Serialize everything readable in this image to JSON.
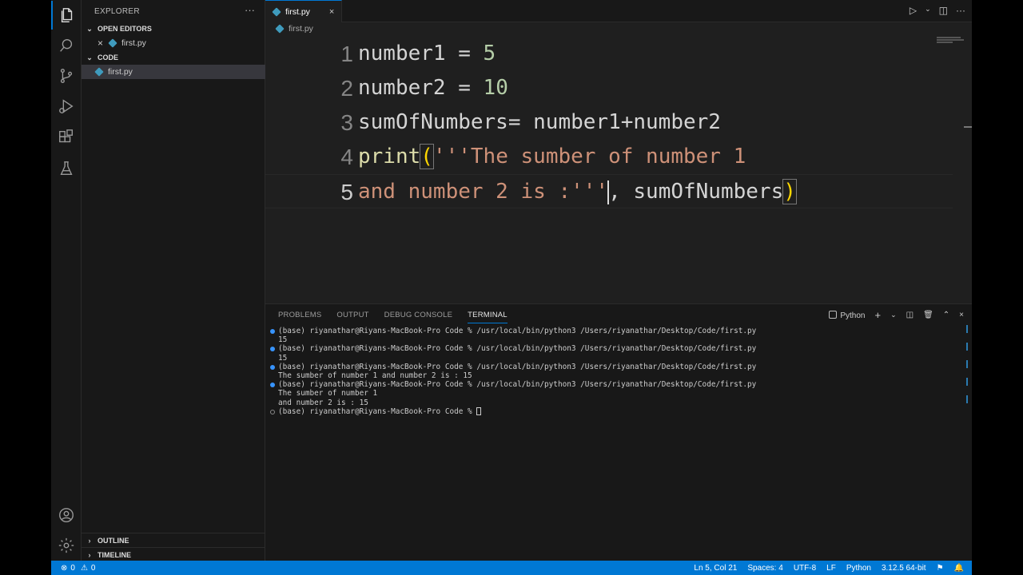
{
  "sidebar": {
    "title": "EXPLORER",
    "more": "···",
    "open_editors": {
      "label": "OPEN EDITORS",
      "items": [
        {
          "name": "first.py"
        }
      ]
    },
    "folder": {
      "label": "CODE",
      "items": [
        {
          "name": "first.py"
        }
      ]
    },
    "outline": "OUTLINE",
    "timeline": "TIMELINE"
  },
  "tab": {
    "label": "first.py",
    "close": "×"
  },
  "breadcrumb": {
    "file": "first.py"
  },
  "editor": {
    "active_line": 5,
    "lines": [
      {
        "n": "1",
        "segs": [
          {
            "t": "number1 = ",
            "c": ""
          },
          {
            "t": "5",
            "c": "num"
          }
        ]
      },
      {
        "n": "2",
        "segs": [
          {
            "t": "number2 = ",
            "c": ""
          },
          {
            "t": "10",
            "c": "num"
          }
        ]
      },
      {
        "n": "3",
        "segs": [
          {
            "t": "sumOfNumbers= number1+number2",
            "c": ""
          }
        ]
      },
      {
        "n": "4",
        "segs": [
          {
            "t": "print",
            "c": "fn"
          },
          {
            "t": "(",
            "c": "par"
          },
          {
            "t": "'''The sumber of number 1",
            "c": "str"
          }
        ]
      },
      {
        "n": "5",
        "segs": [
          {
            "t": "and number 2 is :'''",
            "c": "str"
          },
          {
            "t": "|",
            "c": "caret"
          },
          {
            "t": ", sumOfNumbers",
            "c": ""
          },
          {
            "t": ")",
            "c": "par"
          }
        ]
      }
    ]
  },
  "panel": {
    "tabs": [
      "PROBLEMS",
      "OUTPUT",
      "DEBUG CONSOLE",
      "TERMINAL"
    ],
    "active_tab": "TERMINAL",
    "shell": "Python",
    "terminal_lines": [
      {
        "text": "(base) riyanathar@Riyans-MacBook-Pro Code % /usr/local/bin/python3 /Users/riyanathar/Desktop/Code/first.py",
        "dot": "filled"
      },
      {
        "text": "15",
        "dot": ""
      },
      {
        "text": "(base) riyanathar@Riyans-MacBook-Pro Code % /usr/local/bin/python3 /Users/riyanathar/Desktop/Code/first.py",
        "dot": "filled"
      },
      {
        "text": "15",
        "dot": ""
      },
      {
        "text": "(base) riyanathar@Riyans-MacBook-Pro Code % /usr/local/bin/python3 /Users/riyanathar/Desktop/Code/first.py",
        "dot": "filled"
      },
      {
        "text": "The sumber of number 1 and number 2 is : 15",
        "dot": ""
      },
      {
        "text": "(base) riyanathar@Riyans-MacBook-Pro Code % /usr/local/bin/python3 /Users/riyanathar/Desktop/Code/first.py",
        "dot": "filled"
      },
      {
        "text": "The sumber of number 1",
        "dot": ""
      },
      {
        "text": "and number 2 is : 15",
        "dot": ""
      },
      {
        "text": "(base) riyanathar@Riyans-MacBook-Pro Code % ",
        "dot": "hollow",
        "cursor": true
      }
    ]
  },
  "status": {
    "errors": "0",
    "warnings": "0",
    "position": "Ln 5, Col 21",
    "spaces": "Spaces: 4",
    "encoding": "UTF-8",
    "eol": "LF",
    "language": "Python",
    "interpreter": "3.12.5 64-bit"
  },
  "colors": {
    "accent": "#0078d4",
    "status_bg": "#0078d4",
    "string": "#ce9178",
    "number": "#b5cea8",
    "function": "#dcdcaa"
  }
}
